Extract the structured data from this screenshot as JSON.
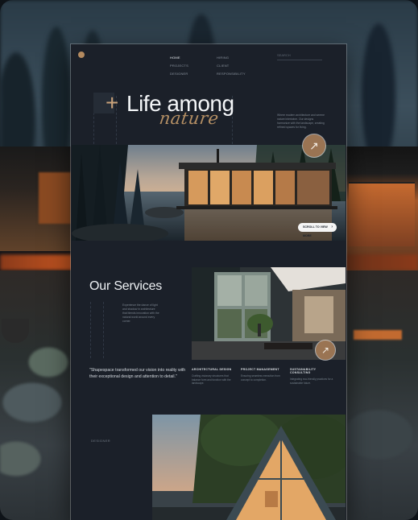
{
  "nav": {
    "column1": [
      "HOME",
      "PROJECTS",
      "DESIGNER"
    ],
    "column2": [
      "HIRING",
      "CLIENT",
      "RESPONSIBILITY"
    ],
    "search_placeholder": "SEARCH"
  },
  "hero": {
    "plus": "+",
    "title": "Life among",
    "script": "nature",
    "description": "Where modern architecture and serene nature intertwine. Our designs harmonize with the landscape, creating refined spaces for living.",
    "scroll_button": "SCROLL TO VIEW MORE",
    "arrow_glyph": "↗"
  },
  "services": {
    "title": "Our Services",
    "description": "Experience the dance of light and shadow in architecture that blends innovation with the natural world around every corner.",
    "quote": "\"Shapespace transformed our vision into reality with their exceptional design and attention to detail.\"",
    "items": [
      {
        "heading": "ARCHITECTURAL DESIGN",
        "desc": "Crafting visionary structures that balance form and function with the landscape."
      },
      {
        "heading": "PROJECT MANAGEMENT",
        "desc": "Ensuring seamless execution from concept to completion."
      },
      {
        "heading": "SUSTAINABILITY CONSULTING",
        "desc": "Integrating eco-friendly practices for a sustainable future."
      }
    ]
  },
  "designer_label": "DESIGNER",
  "colors": {
    "page_bg": "#1b2029",
    "accent_bronze": "#9a7453",
    "script_gold": "#b48f64"
  }
}
